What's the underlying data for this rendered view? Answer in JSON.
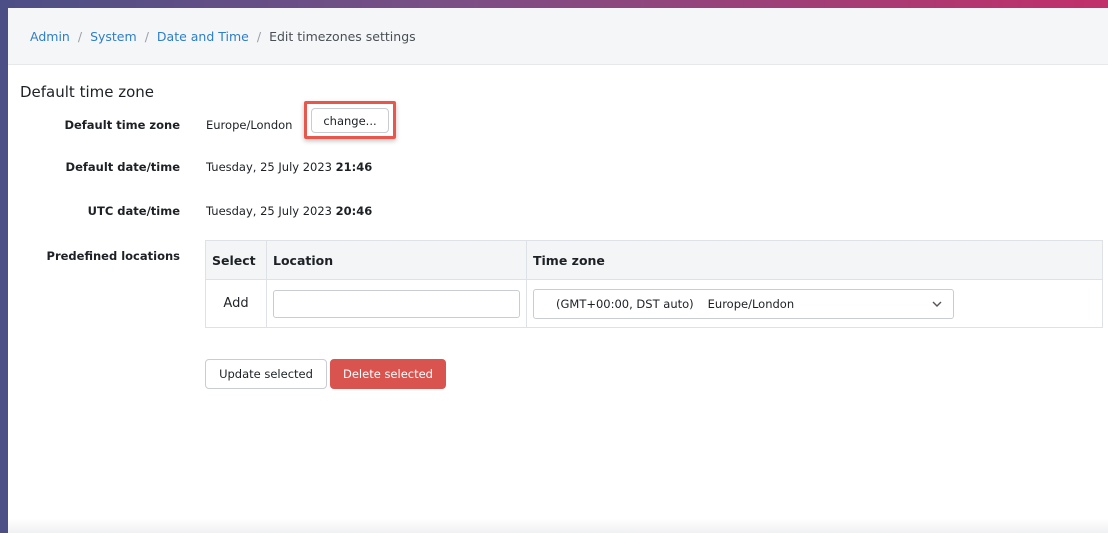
{
  "breadcrumb": {
    "items": [
      "Admin",
      "System",
      "Date and Time"
    ],
    "current": "Edit timezones settings",
    "separator": "/"
  },
  "section_title": "Default time zone",
  "default_timezone": {
    "label": "Default time zone",
    "value": "Europe/London",
    "change_button": "change..."
  },
  "default_datetime": {
    "label": "Default date/time",
    "date": "Tuesday, 25 July 2023",
    "time": "21:46"
  },
  "utc_datetime": {
    "label": "UTC date/time",
    "date": "Tuesday, 25 July 2023",
    "time": "20:46"
  },
  "predefined_locations": {
    "label": "Predefined locations",
    "columns": [
      "Select",
      "Location",
      "Time zone"
    ],
    "row": {
      "select": "Add",
      "location_value": "",
      "timezone_offset": "(GMT+00:00, DST auto)",
      "timezone_name": "Europe/London"
    }
  },
  "buttons": {
    "update": "Update selected",
    "delete": "Delete selected"
  },
  "colors": {
    "link": "#2f7ec7",
    "danger": "#d9534f",
    "highlight": "#e8574b"
  }
}
